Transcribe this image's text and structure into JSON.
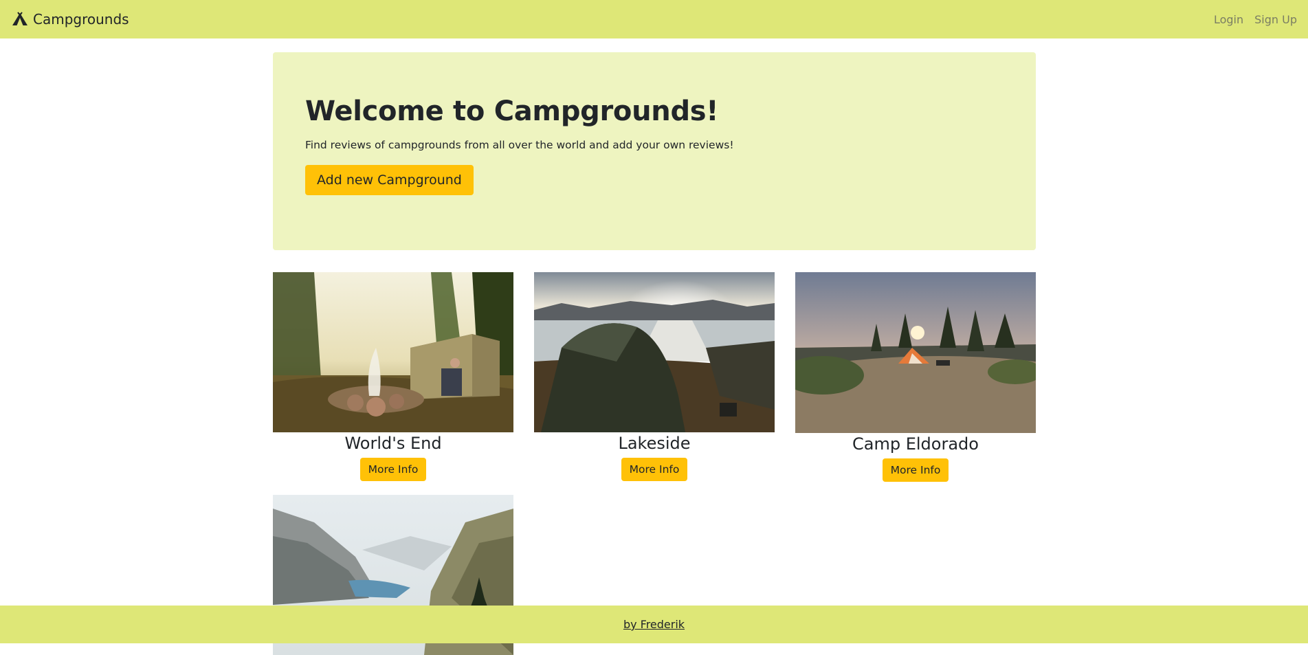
{
  "navbar": {
    "brand": "Campgrounds",
    "brand_icon": "tent-icon",
    "links": [
      {
        "label": "Login"
      },
      {
        "label": "Sign Up"
      }
    ]
  },
  "hero": {
    "title": "Welcome to Campgrounds!",
    "lead": "Find reviews of campgrounds from all over the world and add your own reviews!",
    "add_button": "Add new Campground"
  },
  "campgrounds": [
    {
      "name": "World's End",
      "button": "More Info"
    },
    {
      "name": "Lakeside",
      "button": "More Info"
    },
    {
      "name": "Camp Eldorado",
      "button": "More Info"
    },
    {
      "name": "",
      "button": ""
    }
  ],
  "footer": {
    "link": "by Frederik"
  },
  "colors": {
    "navbar": "#dee777",
    "hero_bg": "#eef4c0",
    "accent_button": "#ffc107",
    "nav_link": "#7a7d63"
  }
}
